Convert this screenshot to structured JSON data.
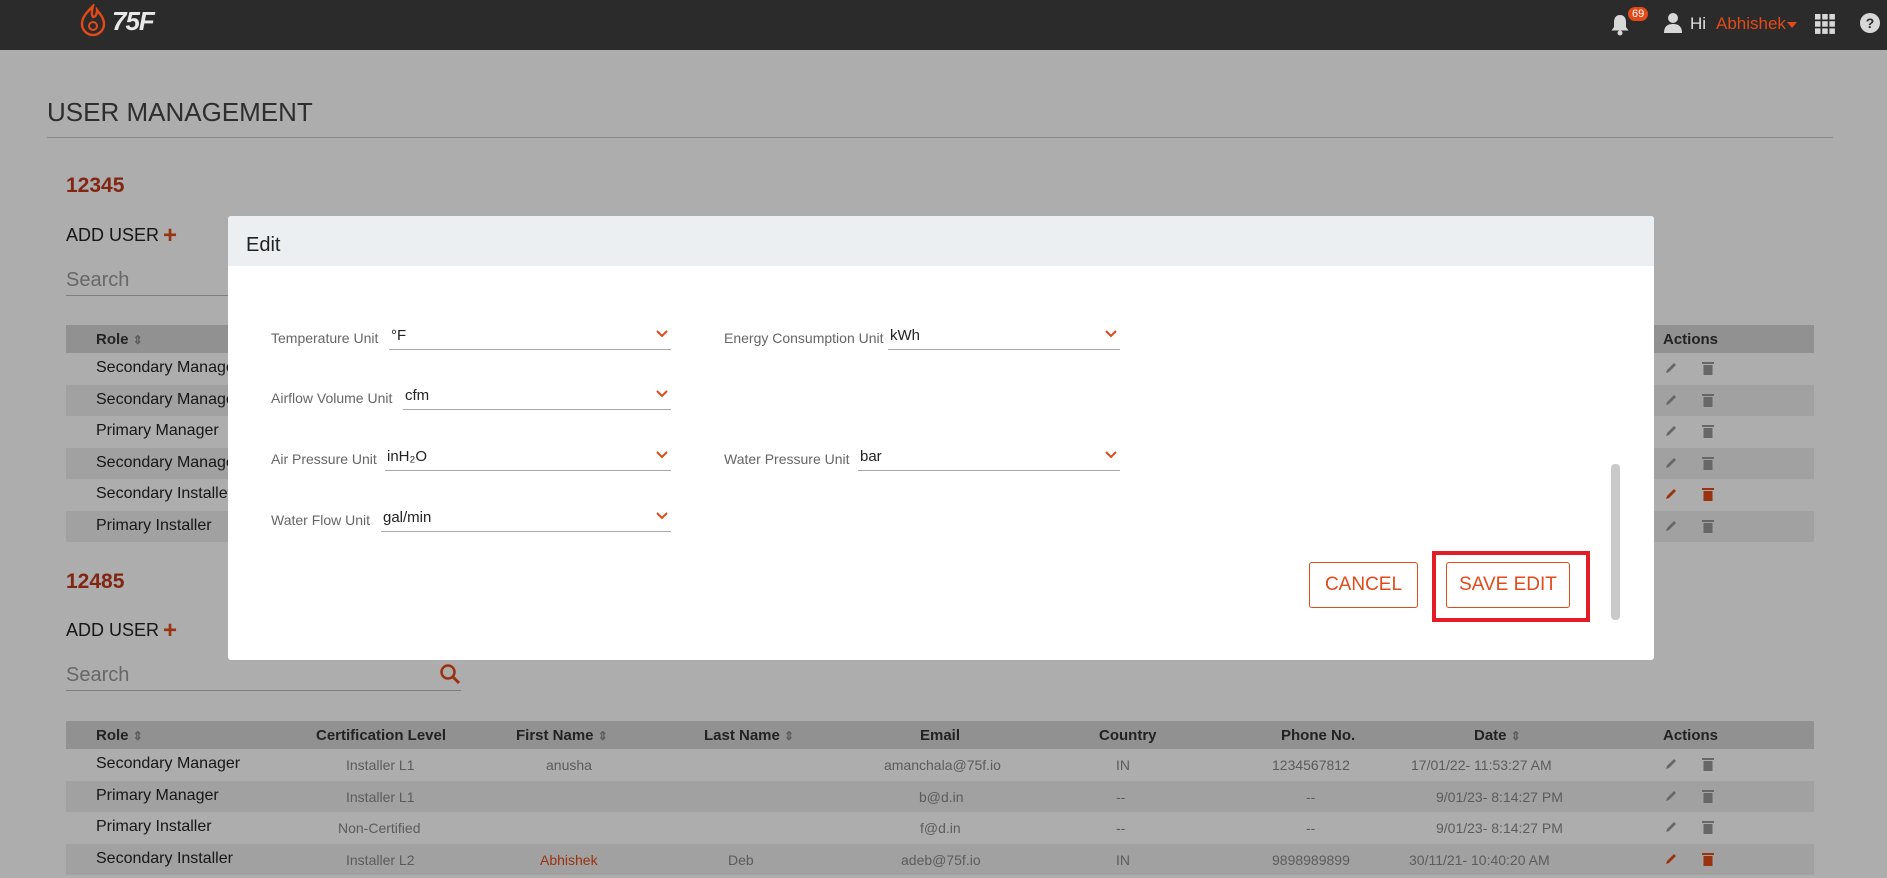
{
  "header": {
    "logo_text": "75F",
    "notification_count": "69",
    "greeting": "Hi",
    "user_name": "Abhishek"
  },
  "page": {
    "title": "USER MANAGEMENT"
  },
  "sites": [
    {
      "id": "12345",
      "add_user_label": "ADD USER",
      "plus": "+",
      "search_placeholder": "Search",
      "columns": [
        "Role",
        "",
        "",
        "",
        "",
        "",
        "",
        "",
        "Actions"
      ],
      "rows": [
        {
          "role": "Secondary Manager"
        },
        {
          "role": "Secondary Manager"
        },
        {
          "role": "Primary Manager"
        },
        {
          "role": "Secondary Manager"
        },
        {
          "role": "Secondary Installer"
        },
        {
          "role": "Primary Installer"
        }
      ]
    },
    {
      "id": "12485",
      "add_user_label": "ADD USER",
      "plus": "+",
      "search_placeholder": "Search",
      "columns": [
        "Role",
        "Certification Level",
        "First Name",
        "Last Name",
        "Email",
        "Country",
        "Phone No.",
        "Date",
        "Actions"
      ],
      "rows": [
        {
          "role": "Secondary Manager",
          "cert": "Installer L1",
          "first": "anusha",
          "last": "",
          "email": "amanchala@75f.io",
          "country": "IN",
          "phone": "1234567812",
          "date": "17/01/22- 11:53:27 AM"
        },
        {
          "role": "Primary Manager",
          "cert": "Installer L1",
          "first": "",
          "last": "",
          "email": "b@d.in",
          "country": "--",
          "phone": "--",
          "date": "9/01/23- 8:14:27 PM"
        },
        {
          "role": "Primary Installer",
          "cert": "Non-Certified",
          "first": "",
          "last": "",
          "email": "f@d.in",
          "country": "--",
          "phone": "--",
          "date": "9/01/23- 8:14:27 PM"
        },
        {
          "role": "Secondary Installer",
          "cert": "Installer L2",
          "first": "Abhishek",
          "last": "Deb",
          "email": "adeb@75f.io",
          "country": "IN",
          "phone": "9898989899",
          "date": "30/11/21- 10:40:20 AM"
        }
      ]
    }
  ],
  "modal": {
    "title": "Edit",
    "fields": {
      "temperature": {
        "label": "Temperature Unit",
        "value": "°F"
      },
      "energy": {
        "label": "Energy Consumption Unit",
        "value": "kWh"
      },
      "airflow": {
        "label": "Airflow Volume Unit",
        "value": "cfm"
      },
      "air_pressure": {
        "label": "Air Pressure Unit",
        "value": "inH₂O"
      },
      "water_pressure": {
        "label": "Water Pressure Unit",
        "value": "bar"
      },
      "water_flow": {
        "label": "Water Flow Unit",
        "value": "gal/min"
      }
    },
    "cancel_label": "CANCEL",
    "save_label": "SAVE EDIT"
  },
  "colors": {
    "accent": "#e24a1a",
    "highlight": "#e31d25",
    "topbar": "#2b2b2b"
  }
}
